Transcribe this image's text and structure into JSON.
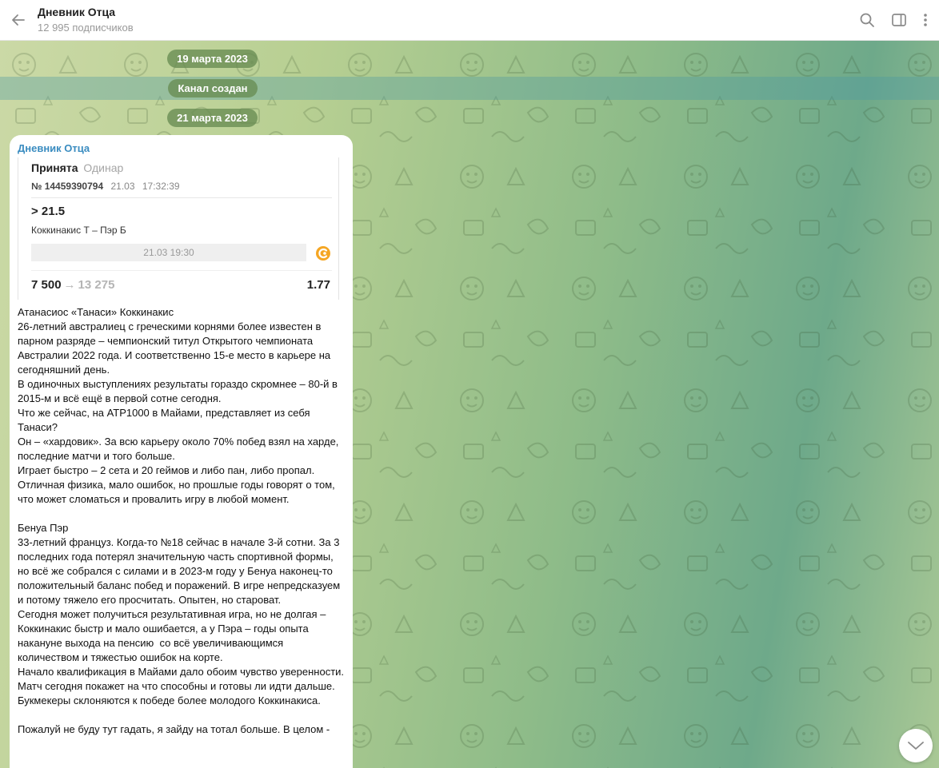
{
  "header": {
    "title": "Дневник Отца",
    "subtitle": "12 995 подписчиков",
    "icons": [
      "back-arrow-icon",
      "search-icon",
      "sidebar-toggle-icon",
      "more-vertical-icon"
    ]
  },
  "service": {
    "date1": "19 марта 2023",
    "channel_created": "Канал создан",
    "date2": "21 марта 2023"
  },
  "message": {
    "author": "Дневник Отца",
    "ticket": {
      "status": "Принята",
      "type": "Одинар",
      "number": "№ 14459390794",
      "date": "21.03",
      "time": "17:32:39",
      "total": "> 21.5",
      "match": "Коккинакис Т – Пэр Б",
      "match_date": "21.03 19:30",
      "stake": "7 500",
      "arrow": "→",
      "potential_win": "13 275",
      "odds": "1.77"
    },
    "text": "Атанасиос «Танаси» Коккинакис\n26-летний австралиец с греческими корнями более известен в парном разряде – чемпионский титул Открытого чемпионата Австралии 2022 года. И соответственно 15-е место в карьере на сегодняшний день.\nВ одиночных выступлениях результаты гораздо скромнее – 80-й в 2015-м и всё ещё в первой сотне сегодня.\nЧто же сейчас, на АТР1000 в Майами, представляет из себя Танаси?\nОн – «хардовик». За всю карьеру около 70% побед взял на харде, последние матчи и того больше.\nИграет быстро – 2 сета и 20 геймов и либо пан, либо пропал. Отличная физика, мало ошибок, но прошлые годы говорят о том, что может сломаться и провалить игру в любой момент.\n\nБенуа Пэр\n33-летний француз. Когда-то №18 сейчас в начале 3-й сотни. За 3 последних года потерял значительную часть спортивной формы, но всё же собрался с силами и в 2023-м году у Бенуа наконец-то положительный баланс побед и поражений. В игре непредсказуем и потому тяжело его просчитать. Опытен, но староват.\nСегодня может получиться результативная игра, но не долгая – Коккинакис быстр и мало ошибается, а у Пэра – годы опыта накануне выхода на пенсию  со всё увеличивающимся количеством и тяжестью ошибок на корте.\nНачало квалификация в Майами дало обоим чувство уверенности. Матч сегодня покажет на что способны и готовы ли идти дальше. Букмекеры склоняются к победе более молодого Коккинакиса.\n\nПожалуй не буду тут гадать, я зайду на тотал больше. В целом -"
  },
  "colors": {
    "accent": "#3a8cc0",
    "service_pill": "#688c52",
    "highlight": "#4a98a4",
    "bookmaker_logo": "#f5a623"
  }
}
